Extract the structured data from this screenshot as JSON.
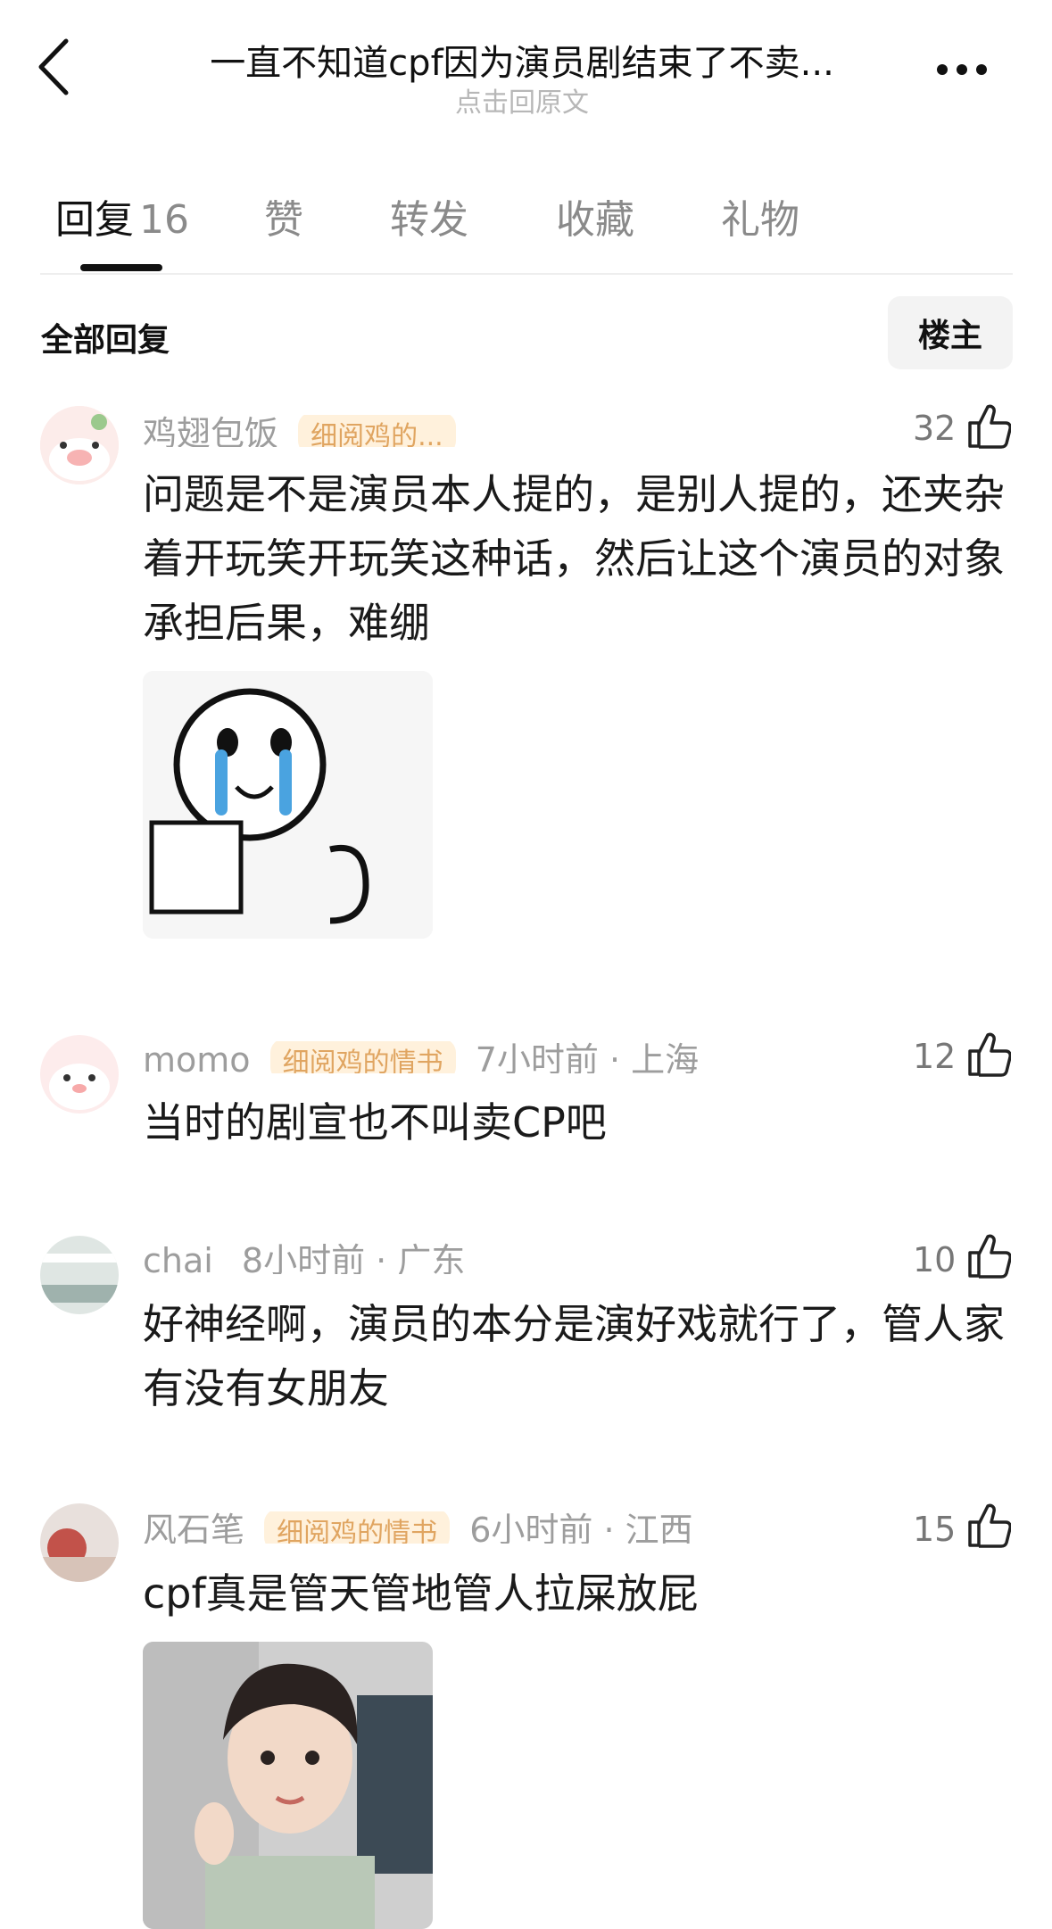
{
  "header": {
    "title": "一直不知道cpf因为演员剧结束了不卖...",
    "subtitle": "点击回原文"
  },
  "tabs": [
    {
      "label": "回复",
      "count": "16"
    },
    {
      "label": "赞"
    },
    {
      "label": "转发"
    },
    {
      "label": "收藏"
    },
    {
      "label": "礼物"
    }
  ],
  "section": {
    "all_replies": "全部回复",
    "op_filter": "楼主"
  },
  "comments": [
    {
      "meta": "鸡翅包饭",
      "badge": "细阅鸡的...",
      "likes": "32",
      "text": "问题是不是演员本人提的，是别人提的，还夹杂着开玩笑开玩笑这种话，然后让这个演员的对象承担后果，难绷",
      "image_icon": "crying-sticker-image"
    },
    {
      "meta": "momo",
      "badge": "细阅鸡的情书",
      "meta_tail": "7小时前 · 上海",
      "likes": "12",
      "text": "当时的剧宣也不叫卖CP吧"
    },
    {
      "meta": "chai",
      "meta_tail": "8小时前 · 广东",
      "likes": "10",
      "text": "好神经啊，演员的本分是演好戏就行了，管人家有没有女朋友"
    },
    {
      "meta": "风石笔",
      "badge": "细阅鸡的情书",
      "meta_tail": "6小时前 · 江西",
      "likes": "15",
      "text": "cpf真是管天管地管人拉屎放屁",
      "image_icon": "actor-photo-image"
    }
  ],
  "colors": {
    "accent": "#111111",
    "muted": "#8a8a8a",
    "badge_bg": "#fff1dc",
    "badge_text": "#e0a561"
  }
}
